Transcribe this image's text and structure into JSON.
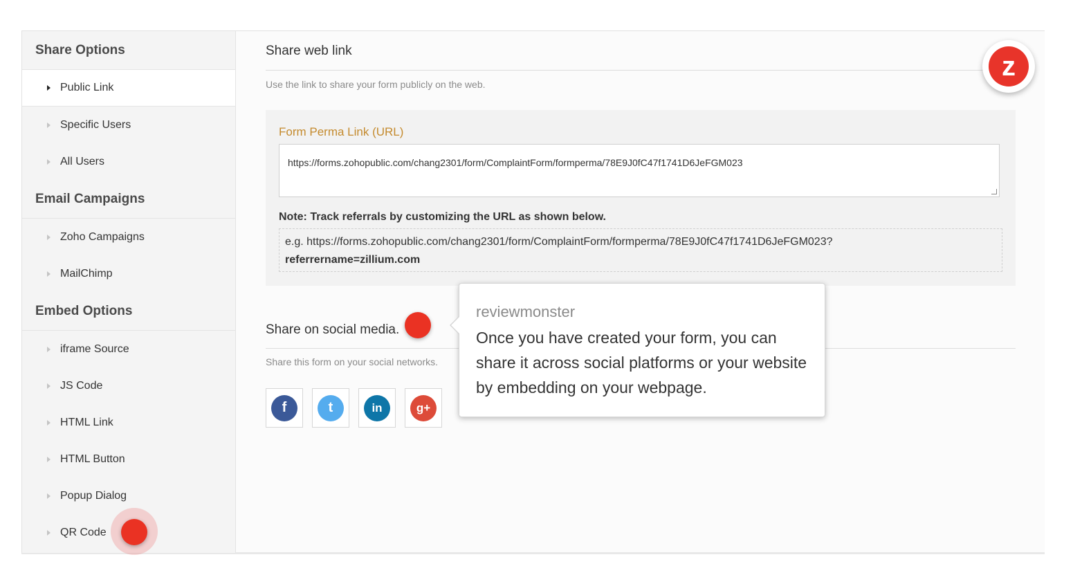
{
  "sidebar": {
    "sections": [
      {
        "title": "Share Options",
        "items": [
          "Public Link",
          "Specific Users",
          "All Users"
        ]
      },
      {
        "title": "Email Campaigns",
        "items": [
          "Zoho Campaigns",
          "MailChimp"
        ]
      },
      {
        "title": "Embed Options",
        "items": [
          "iframe Source",
          "JS Code",
          "HTML Link",
          "HTML Button",
          "Popup Dialog",
          "QR Code"
        ]
      }
    ],
    "active_item": "Public Link"
  },
  "main": {
    "title": "Share web link",
    "description": "Use the link to share your form publicly on the web.",
    "perma_label": "Form Perma Link (URL)",
    "perma_url": "https://forms.zohopublic.com/chang2301/form/ComplaintForm/formperma/78E9J0fC47f1741D6JeFGM023",
    "note": "Note: Track referrals by customizing the URL as shown below.",
    "example_prefix": "e.g. https://forms.zohopublic.com/chang2301/form/ComplaintForm/formperma/78E9J0fC47f1741D6JeFGM023?",
    "example_param": "referrername=zillium.com",
    "social_title": "Share on social media.",
    "social_desc": "Share this form on your social networks.",
    "social_icons": [
      {
        "name": "facebook-icon",
        "glyph": "f",
        "color": "#3b5998"
      },
      {
        "name": "twitter-icon",
        "glyph": "t",
        "color": "#55acee"
      },
      {
        "name": "linkedin-icon",
        "glyph": "in",
        "color": "#0e76a8"
      },
      {
        "name": "google-plus-icon",
        "glyph": "g+",
        "color": "#dd4b39"
      }
    ]
  },
  "tooltip": {
    "author": "reviewmonster",
    "body": "Once you have created your form, you can share it across social platforms or your website by embedding on your webpage."
  },
  "logo": {
    "glyph": "z",
    "color": "#e8342a"
  }
}
